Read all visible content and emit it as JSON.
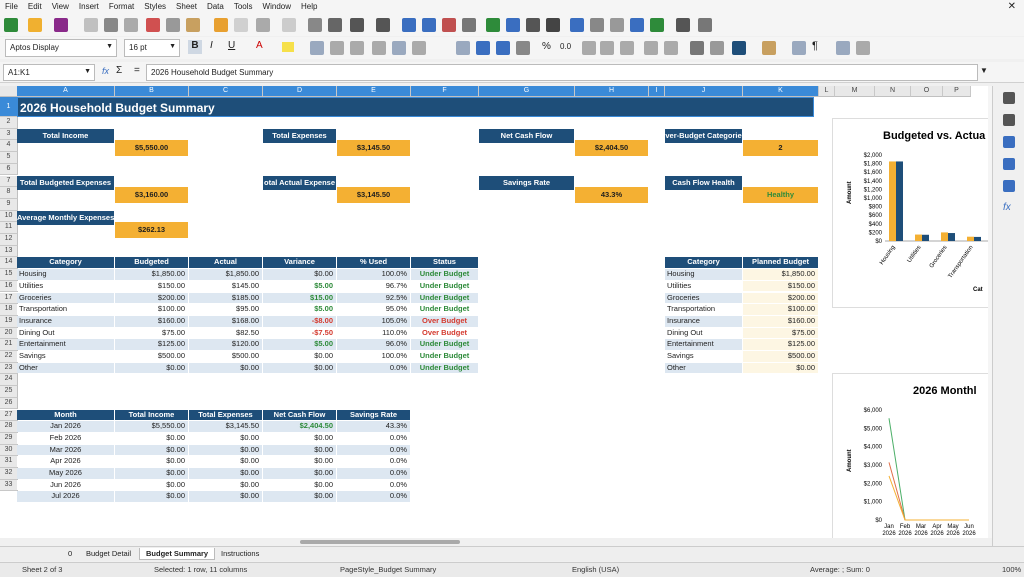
{
  "menu": [
    "File",
    "Edit",
    "View",
    "Insert",
    "Format",
    "Styles",
    "Sheet",
    "Data",
    "Tools",
    "Window",
    "Help"
  ],
  "toolbar": {
    "font_name": "Aptos Display",
    "font_size": "16 pt"
  },
  "formula_bar": {
    "name_box": "A1:K1",
    "fx": "fx",
    "sigma": "Σ",
    "equals": "=",
    "content": "2026 Household Budget Summary"
  },
  "columns": [
    "A",
    "B",
    "C",
    "D",
    "E",
    "F",
    "G",
    "H",
    "I",
    "J",
    "K",
    "L",
    "M",
    "N",
    "O",
    "P"
  ],
  "rows": [
    "1",
    "2",
    "3",
    "4",
    "5",
    "6",
    "7",
    "8",
    "9",
    "10",
    "11",
    "12",
    "13",
    "14",
    "15",
    "16",
    "17",
    "18",
    "19",
    "20",
    "21",
    "22",
    "23",
    "24",
    "25",
    "26",
    "27",
    "28",
    "29",
    "30",
    "31",
    "32",
    "33"
  ],
  "title": "2026 Household Budget Summary",
  "kpis": [
    {
      "label": "Total Income",
      "value": "$5,550.00"
    },
    {
      "label": "Total Expenses",
      "value": "$3,145.50"
    },
    {
      "label": "Net Cash Flow",
      "value": "$2,404.50"
    },
    {
      "label": "ver-Budget Categorie",
      "value": "2"
    },
    {
      "label": "Total Budgeted Expenses",
      "value": "$3,160.00"
    },
    {
      "label": "otal Actual Expense",
      "value": "$3,145.50"
    },
    {
      "label": "Savings Rate",
      "value": "43.3%"
    },
    {
      "label": "Cash Flow Health",
      "value": "Healthy"
    },
    {
      "label": "Average Monthly Expenses",
      "value": "$262.13"
    }
  ],
  "cat_table": {
    "headers": [
      "Category",
      "Budgeted",
      "Actual",
      "Variance",
      "% Used",
      "Status"
    ],
    "rows": [
      [
        "Housing",
        "$1,850.00",
        "$1,850.00",
        "$0.00",
        "100.0%",
        "Under Budget"
      ],
      [
        "Utilities",
        "$150.00",
        "$145.00",
        "$5.00",
        "96.7%",
        "Under Budget"
      ],
      [
        "Groceries",
        "$200.00",
        "$185.00",
        "$15.00",
        "92.5%",
        "Under Budget"
      ],
      [
        "Transportation",
        "$100.00",
        "$95.00",
        "$5.00",
        "95.0%",
        "Under Budget"
      ],
      [
        "Insurance",
        "$160.00",
        "$168.00",
        "-$8.00",
        "105.0%",
        "Over Budget"
      ],
      [
        "Dining Out",
        "$75.00",
        "$82.50",
        "-$7.50",
        "110.0%",
        "Over Budget"
      ],
      [
        "Entertainment",
        "$125.00",
        "$120.00",
        "$5.00",
        "96.0%",
        "Under Budget"
      ],
      [
        "Savings",
        "$500.00",
        "$500.00",
        "$0.00",
        "100.0%",
        "Under Budget"
      ],
      [
        "Other",
        "$0.00",
        "$0.00",
        "$0.00",
        "0.0%",
        "Under Budget"
      ]
    ]
  },
  "plan_table": {
    "headers": [
      "Category",
      "Planned Budget"
    ],
    "rows": [
      [
        "Housing",
        "$1,850.00"
      ],
      [
        "Utilities",
        "$150.00"
      ],
      [
        "Groceries",
        "$200.00"
      ],
      [
        "Transportation",
        "$100.00"
      ],
      [
        "Insurance",
        "$160.00"
      ],
      [
        "Dining Out",
        "$75.00"
      ],
      [
        "Entertainment",
        "$125.00"
      ],
      [
        "Savings",
        "$500.00"
      ],
      [
        "Other",
        "$0.00"
      ]
    ]
  },
  "month_table": {
    "headers": [
      "Month",
      "Total Income",
      "Total Expenses",
      "Net Cash Flow",
      "Savings Rate"
    ],
    "rows": [
      [
        "Jan 2026",
        "$5,550.00",
        "$3,145.50",
        "$2,404.50",
        "43.3%"
      ],
      [
        "Feb 2026",
        "$0.00",
        "$0.00",
        "$0.00",
        "0.0%"
      ],
      [
        "Mar 2026",
        "$0.00",
        "$0.00",
        "$0.00",
        "0.0%"
      ],
      [
        "Apr 2026",
        "$0.00",
        "$0.00",
        "$0.00",
        "0.0%"
      ],
      [
        "May 2026",
        "$0.00",
        "$0.00",
        "$0.00",
        "0.0%"
      ],
      [
        "Jun 2026",
        "$0.00",
        "$0.00",
        "$0.00",
        "0.0%"
      ],
      [
        "Jul 2026",
        "$0.00",
        "$0.00",
        "$0.00",
        "0.0%"
      ]
    ]
  },
  "chart_data": [
    {
      "type": "bar",
      "title": "Budgeted vs. Actua",
      "ylabel": "Amount",
      "xlabel": "Cat",
      "yticks": [
        "$2,000",
        "$1,800",
        "$1,600",
        "$1,400",
        "$1,200",
        "$1,000",
        "$800",
        "$600",
        "$400",
        "$200",
        "$0"
      ],
      "ylim": [
        0,
        2000
      ],
      "categories": [
        "Housing",
        "Utilities",
        "Groceries",
        "Transportation",
        "Ins"
      ],
      "series": [
        {
          "values": [
            1850,
            150,
            200,
            100,
            160
          ],
          "color": "#f4b033"
        },
        {
          "values": [
            1850,
            145,
            185,
            95,
            168
          ],
          "color": "#1e4e79"
        }
      ]
    },
    {
      "type": "line",
      "title": "2026 Monthl",
      "ylabel": "Amount",
      "yticks": [
        "$6,000",
        "$5,000",
        "$4,000",
        "$3,000",
        "$2,000",
        "$1,000",
        "$0"
      ],
      "ylim": [
        0,
        6000
      ],
      "categories": [
        "Jan 2026",
        "Feb 2026",
        "Mar 2026",
        "Apr 2026",
        "May 2026",
        "Jun 2026"
      ],
      "series": [
        {
          "values": [
            5550,
            0,
            0,
            0,
            0,
            0
          ],
          "color": "#4caf68"
        },
        {
          "values": [
            3145.5,
            0,
            0,
            0,
            0,
            0
          ],
          "color": "#e0704a"
        },
        {
          "values": [
            2404.5,
            0,
            0,
            0,
            0,
            0
          ],
          "color": "#f4b033"
        }
      ]
    }
  ],
  "sheet_tabs": [
    "0",
    "Budget Detail",
    "Budget Summary",
    "Instructions"
  ],
  "status": {
    "sheet": "Sheet 2 of 3",
    "selected": "Selected: 1 row, 11 columns",
    "pagestyle": "PageStyle_Budget Summary",
    "lang": "English (USA)",
    "sum": "Average: ; Sum: 0",
    "zoom": "100%"
  },
  "colors": {
    "navy": "#1e4e79",
    "gold": "#f4b033",
    "selection": "#3a8ad8"
  }
}
